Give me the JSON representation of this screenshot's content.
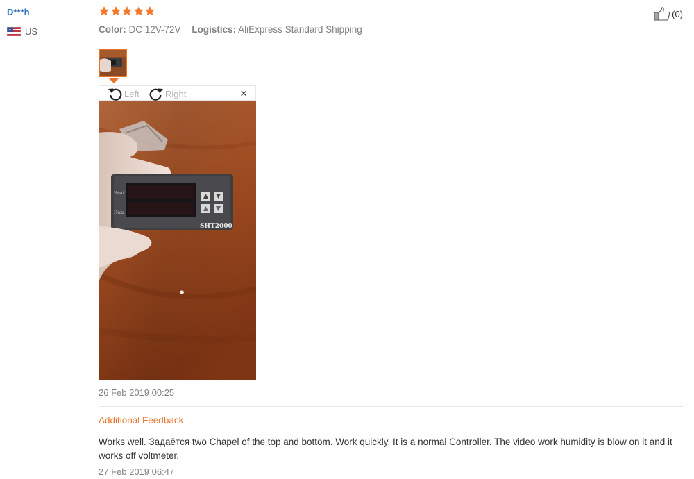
{
  "review": {
    "user": {
      "name": "D***h",
      "country": "US"
    },
    "rating": 5,
    "color_label": "Color:",
    "color_value": "DC 12V-72V",
    "logistics_label": "Logistics:",
    "logistics_value": "AliExpress Standard Shipping",
    "helpful_count": "(0)",
    "viewer": {
      "rotate_left": "Left",
      "rotate_right": "Right",
      "close": "×"
    },
    "photo": {
      "device_labels": [
        "Heat",
        "Hum"
      ],
      "device_model": "SHT2000"
    },
    "date": "26 Feb 2019 00:25",
    "additional_feedback": {
      "title": "Additional Feedback",
      "text": "Works well. Задаётся two Chapel of the top and bottom. Work quickly. It is a normal Controller. The video work humidity is blow on it and it works off voltmeter.",
      "date": "27 Feb 2019 06:47"
    }
  },
  "colors": {
    "accent": "#e8742a",
    "username": "#2d6ebf",
    "star": "#f2792a"
  },
  "icons": {
    "flag": "us-flag-icon",
    "helpful": "thumbs-up-icon",
    "rotate_left": "rotate-left-icon",
    "rotate_right": "rotate-right-icon",
    "close": "close-icon"
  }
}
